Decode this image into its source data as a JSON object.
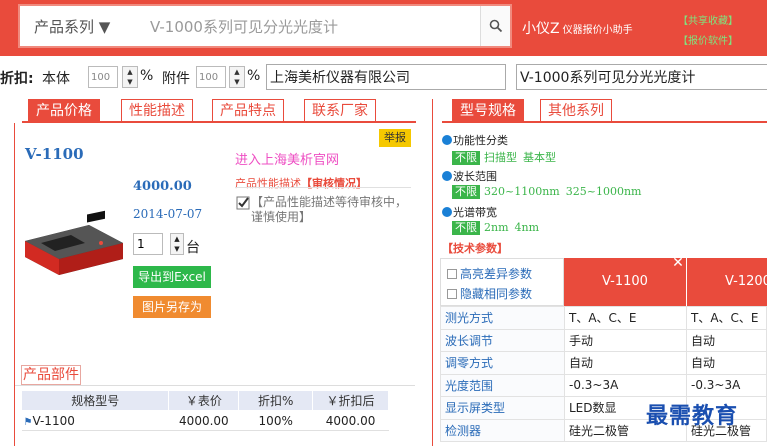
{
  "colors": {
    "accent": "#e94b3c",
    "link_blue": "#2a6bb8",
    "green": "#3bb54a",
    "pink": "#ee4fc3",
    "orange": "#f08b30",
    "yellow": "#f5c800"
  },
  "header": {
    "category_select": "产品系列 ▼",
    "search_placeholder": "V-1000系列可见分光光度计",
    "brand_name": "小仪Z",
    "brand_tagline": "仪器报价小助手",
    "link_1": "【共享收藏】",
    "link_2": "【报价软件】",
    "search_icon": "search-icon"
  },
  "discount": {
    "label_discount": "折扣:",
    "label_body": "本体",
    "body_value": "100",
    "percent_1": "%",
    "label_accessory": "附件",
    "accessory_value": "100",
    "percent_2": "%",
    "company": "上海美析仪器有限公司",
    "product": "V-1000系列可见分光光度计"
  },
  "left_tabs": [
    "产品价格",
    "性能描述",
    "产品特点",
    "联系厂家"
  ],
  "product": {
    "name": "V-1100",
    "price": "4000.00",
    "date": "2014-07-07",
    "qty": "1",
    "qty_unit": "台",
    "export_excel": "导出到Excel",
    "save_image": "图片另存为",
    "report": "举报",
    "official_site": "进入上海美析官网",
    "perf_desc_label": "产品性能描述",
    "perf_desc_status": "【审核情况】",
    "pending_text": "【产品性能描述等待审核中，谨慎使用】"
  },
  "parts": {
    "title": "产品部件",
    "headers": [
      "规格型号",
      "￥表价",
      "折扣%",
      "￥折扣后"
    ],
    "rows": [
      {
        "model": "V-1100",
        "list_price": "4000.00",
        "discount": "100%",
        "after_discount": "4000.00"
      }
    ]
  },
  "right_tabs": [
    "型号规格",
    "其他系列"
  ],
  "filters": [
    {
      "title": "功能性分类",
      "all": "不限",
      "options": [
        "扫描型",
        "基本型"
      ]
    },
    {
      "title": "波长范围",
      "all": "不限",
      "options": [
        "320~1100nm",
        "325~1000nm"
      ]
    },
    {
      "title": "光谱带宽",
      "all": "不限",
      "options": [
        "2nm",
        "4nm"
      ]
    }
  ],
  "tech_params": {
    "title": "【技术参数】",
    "option_highlight": "高亮差异参数",
    "option_hide_same": "隐藏相同参数",
    "columns": [
      "V-1100",
      "V-1200"
    ],
    "rows": [
      {
        "key": "测光方式",
        "v1": "T、A、C、E",
        "v2": "T、A、C、E"
      },
      {
        "key": "波长调节",
        "v1": "手动",
        "v2": "自动"
      },
      {
        "key": "调零方式",
        "v1": "自动",
        "v2": "自动"
      },
      {
        "key": "光度范围",
        "v1": "-0.3~3A",
        "v2": "-0.3~3A"
      },
      {
        "key": "显示屏类型",
        "v1": "LED数显",
        "v2": ""
      },
      {
        "key": "检测器",
        "v1": "硅光二极管",
        "v2": "硅光二极管"
      }
    ]
  },
  "watermark": "最需教育"
}
